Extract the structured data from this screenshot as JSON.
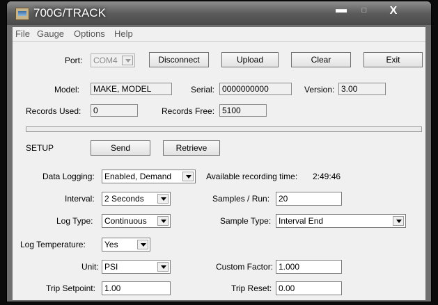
{
  "window": {
    "title": "700G/TRACK",
    "minimize": "▬",
    "maximize": "□",
    "close": "X"
  },
  "menu": [
    "File",
    "Gauge",
    "Options",
    "Help"
  ],
  "connection": {
    "port_label": "Port:",
    "port_value": "COM4",
    "disconnect": "Disconnect",
    "upload": "Upload",
    "clear": "Clear",
    "exit": "Exit"
  },
  "device": {
    "model_label": "Model:",
    "model_value": "MAKE, MODEL",
    "serial_label": "Serial:",
    "serial_value": "0000000000",
    "version_label": "Version:",
    "version_value": "3.00",
    "records_used_label": "Records Used:",
    "records_used_value": "0",
    "records_free_label": "Records Free:",
    "records_free_value": "5100"
  },
  "progress": {
    "percent": 0,
    "color": "#4cb848"
  },
  "setup": {
    "label": "SETUP",
    "send": "Send",
    "retrieve": "Retrieve",
    "data_logging_label": "Data Logging:",
    "data_logging_value": "Enabled, Demand",
    "recording_time_label": "Available recording time:",
    "recording_time_value": "2:49:46",
    "interval_label": "Interval:",
    "interval_value": "2 Seconds",
    "samples_run_label": "Samples / Run:",
    "samples_run_value": "20",
    "log_type_label": "Log Type:",
    "log_type_value": "Continuous",
    "sample_type_label": "Sample Type:",
    "sample_type_value": "Interval End",
    "log_temp_label": "Log Temperature:",
    "log_temp_value": "Yes",
    "unit_label": "Unit:",
    "unit_value": "PSI",
    "custom_factor_label": "Custom Factor:",
    "custom_factor_value": "1.000",
    "trip_setpoint_label": "Trip Setpoint:",
    "trip_setpoint_value": "1.00",
    "trip_reset_label": "Trip Reset:",
    "trip_reset_value": "0.00"
  }
}
